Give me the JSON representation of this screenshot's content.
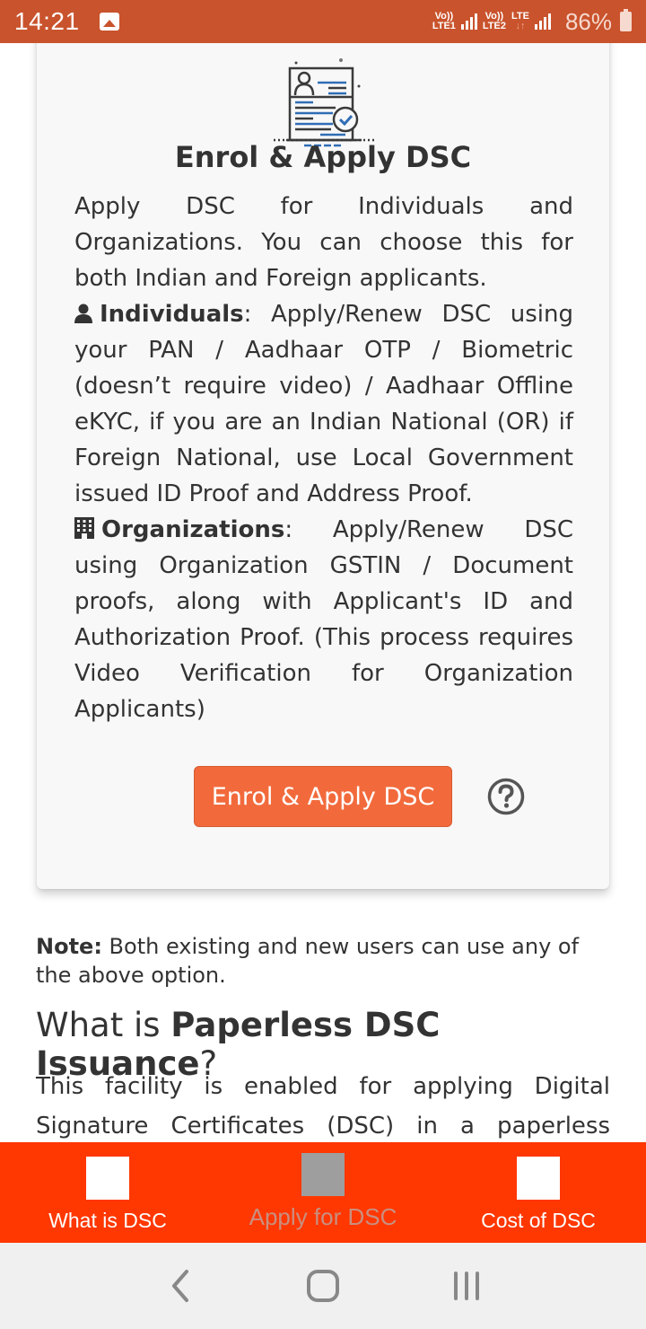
{
  "status_bar": {
    "time": "14:21",
    "sim1_label_top": "Vo))",
    "sim1_label_bottom": "LTE1",
    "sim2_label_top": "Vo))",
    "sim2_label_bottom": "LTE2",
    "data_label": "LTE",
    "battery": "86%"
  },
  "card": {
    "illustration": "certificate-document-icon",
    "title": "Enrol & Apply DSC",
    "intro": "Apply DSC for Individuals and Organizations. You can choose this for both Indian and Foreign applicants.",
    "individuals": {
      "icon": "user-icon",
      "label": "Individuals",
      "text": ": Apply/Renew DSC using your PAN / Aadhaar OTP / Biometric (doesn’t require video) / Aadhaar Offline eKYC, if you are an Indian National (OR) if Foreign National, use Local Government issued ID Proof and Address Proof."
    },
    "organizations": {
      "icon": "building-icon",
      "label": "Organizations",
      "text": ": Apply/Renew DSC using Organization GSTIN / Document proofs, along with Applicant's ID and Authorization Proof. (This process requires Video Verification for Organization Applicants)"
    },
    "button_label": "Enrol & Apply DSC",
    "help_icon": "question-circle-icon"
  },
  "note": {
    "label": "Note:",
    "text": " Both existing and new users can use any of the above option."
  },
  "section": {
    "heading_plain": "What is ",
    "heading_bold": "Paperless DSC Issuance",
    "heading_end": "?",
    "paragraph": "This facility is enabled for applying Digital Signature Certificates (DSC) in a paperless"
  },
  "bottom_nav": {
    "items": [
      {
        "label": "What is DSC",
        "active": false
      },
      {
        "label": "Apply for DSC",
        "active": true
      },
      {
        "label": "Cost of DSC",
        "active": false
      }
    ],
    "background": "#ff3700"
  },
  "colors": {
    "status_bar": "#c9532c",
    "accent_button": "#f26a3c",
    "icon_blue": "#2f6db5"
  }
}
